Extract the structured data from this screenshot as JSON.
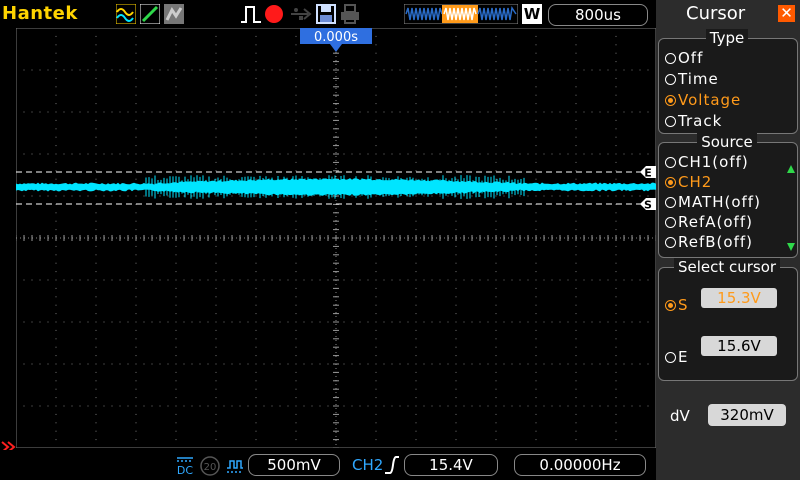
{
  "brand": "Hantek",
  "timebase": "800us",
  "memory_indicator": "W",
  "trigger_position": "0.000s",
  "channel_coupling": "DC",
  "bw_limit": "20",
  "volts_per_div": "500mV",
  "trigger_channel": "CH2",
  "trigger_level": "15.4V",
  "frequency": "0.00000Hz",
  "markers": {
    "end": "E",
    "start": "S"
  },
  "panel": {
    "title": "Cursor",
    "type": {
      "title": "Type",
      "options": [
        "Off",
        "Time",
        "Voltage",
        "Track"
      ],
      "selected": 2
    },
    "source": {
      "title": "Source",
      "options": [
        "CH1(off)",
        "CH2",
        "MATH(off)",
        "RefA(off)",
        "RefB(off)"
      ],
      "selected": 1
    },
    "select_cursor": {
      "title": "Select cursor",
      "s_label": "S",
      "s_value": "15.3V",
      "e_label": "E",
      "e_value": "15.6V"
    },
    "dv_label": "dV",
    "dv_value": "320mV"
  },
  "colors": {
    "brand": "#ffd400",
    "trace": "#00e5ff",
    "selected": "#ff9a1a",
    "trigger_marker": "#2f6fe0",
    "close_button": "#ff5a00"
  }
}
